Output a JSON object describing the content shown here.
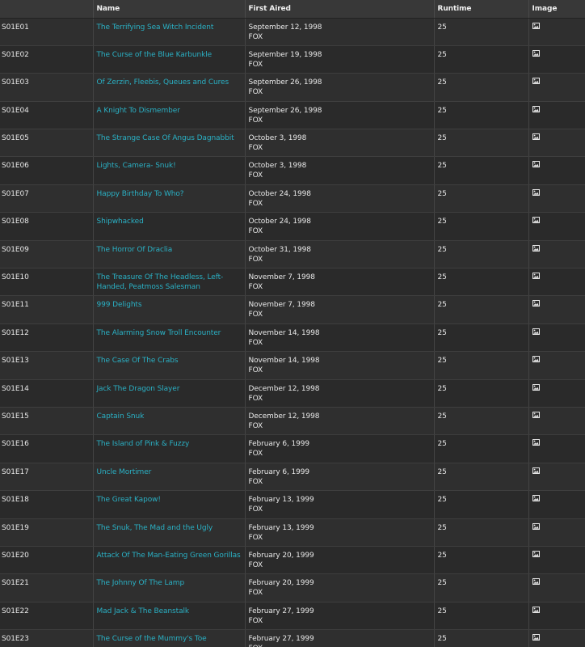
{
  "header": {
    "num_label": "",
    "name_label": "Name",
    "aired_label": "First Aired",
    "runtime_label": "Runtime",
    "image_label": "Image"
  },
  "icons": {
    "image": "image-icon"
  },
  "colors": {
    "link": "#2ab0c4",
    "background": "#2b2b2b"
  },
  "episodes": [
    {
      "num": "S01E01",
      "name": "The Terrifying Sea Witch Incident",
      "date": "September 12, 1998",
      "network": "FOX",
      "runtime": "25"
    },
    {
      "num": "S01E02",
      "name": "The Curse of the Blue Karbunkle",
      "date": "September 19, 1998",
      "network": "FOX",
      "runtime": "25"
    },
    {
      "num": "S01E03",
      "name": "Of Zerzin, Fleebis, Queues and Cures",
      "date": "September 26, 1998",
      "network": "FOX",
      "runtime": "25"
    },
    {
      "num": "S01E04",
      "name": "A Knight To Dismember",
      "date": "September 26, 1998",
      "network": "FOX",
      "runtime": "25"
    },
    {
      "num": "S01E05",
      "name": "The Strange Case Of Angus Dagnabbit",
      "date": "October 3, 1998",
      "network": "FOX",
      "runtime": "25"
    },
    {
      "num": "S01E06",
      "name": "Lights, Camera- Snuk!",
      "date": "October 3, 1998",
      "network": "FOX",
      "runtime": "25"
    },
    {
      "num": "S01E07",
      "name": "Happy Birthday To Who?",
      "date": "October 24, 1998",
      "network": "FOX",
      "runtime": "25"
    },
    {
      "num": "S01E08",
      "name": "Shipwhacked",
      "date": "October 24, 1998",
      "network": "FOX",
      "runtime": "25"
    },
    {
      "num": "S01E09",
      "name": "The Horror Of Draclia",
      "date": "October 31, 1998",
      "network": "FOX",
      "runtime": "25"
    },
    {
      "num": "S01E10",
      "name": "The Treasure Of The Headless, Left-Handed, Peatmoss Salesman",
      "date": "November 7, 1998",
      "network": "FOX",
      "runtime": "25"
    },
    {
      "num": "S01E11",
      "name": "999 Delights",
      "date": "November 7, 1998",
      "network": "FOX",
      "runtime": "25"
    },
    {
      "num": "S01E12",
      "name": "The Alarming Snow Troll Encounter",
      "date": "November 14, 1998",
      "network": "FOX",
      "runtime": "25"
    },
    {
      "num": "S01E13",
      "name": "The Case Of The Crabs",
      "date": "November 14, 1998",
      "network": "FOX",
      "runtime": "25"
    },
    {
      "num": "S01E14",
      "name": "Jack The Dragon Slayer",
      "date": "December 12, 1998",
      "network": "FOX",
      "runtime": "25"
    },
    {
      "num": "S01E15",
      "name": "Captain Snuk",
      "date": "December 12, 1998",
      "network": "FOX",
      "runtime": "25"
    },
    {
      "num": "S01E16",
      "name": "The Island of Pink & Fuzzy",
      "date": "February 6, 1999",
      "network": "FOX",
      "runtime": "25"
    },
    {
      "num": "S01E17",
      "name": "Uncle Mortimer",
      "date": "February 6, 1999",
      "network": "FOX",
      "runtime": "25"
    },
    {
      "num": "S01E18",
      "name": "The Great Kapow!",
      "date": "February 13, 1999",
      "network": "FOX",
      "runtime": "25"
    },
    {
      "num": "S01E19",
      "name": "The Snuk, The Mad and the Ugly",
      "date": "February 13, 1999",
      "network": "FOX",
      "runtime": "25"
    },
    {
      "num": "S01E20",
      "name": "Attack Of The Man-Eating Green Gorillas",
      "date": "February 20, 1999",
      "network": "FOX",
      "runtime": "25"
    },
    {
      "num": "S01E21",
      "name": "The Johnny Of The Lamp",
      "date": "February 20, 1999",
      "network": "FOX",
      "runtime": "25"
    },
    {
      "num": "S01E22",
      "name": "Mad Jack & The Beanstalk",
      "date": "February 27, 1999",
      "network": "FOX",
      "runtime": "25"
    },
    {
      "num": "S01E23",
      "name": "The Curse of the Mummy's Toe",
      "date": "February 27, 1999",
      "network": "FOX",
      "runtime": "25"
    }
  ]
}
